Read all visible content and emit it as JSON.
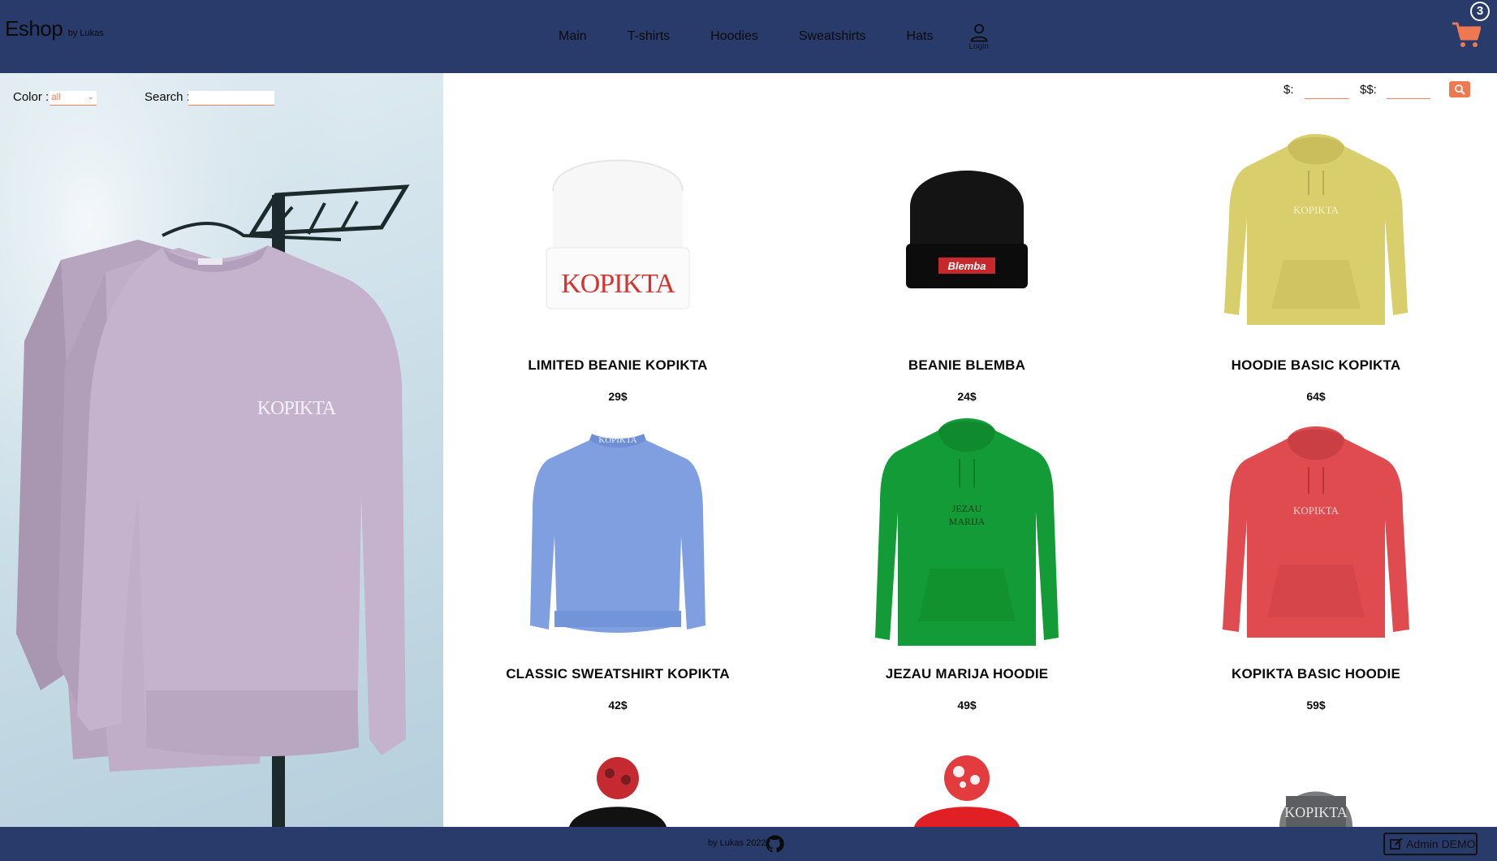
{
  "header": {
    "brand": "Eshop",
    "brand_by": "by Lukas",
    "nav": [
      "Main",
      "T-shirts",
      "Hoodies",
      "Sweatshirts",
      "Hats"
    ],
    "login_label": "Login",
    "cart_count": "3",
    "icons": {
      "login": "user-icon",
      "cart": "cart-icon"
    }
  },
  "filters": {
    "color_label": "Color :",
    "color_value": "all",
    "search_label": "Search :",
    "search_value": ""
  },
  "price_filter": {
    "min_label": "$:",
    "max_label": "$$:",
    "min_value": "",
    "max_value": ""
  },
  "products": [
    {
      "title": "LIMITED BEANIE KOPIKTA",
      "price": "29$",
      "color": "#f5f5f5",
      "kind": "beanie",
      "print": "KOPIKTA"
    },
    {
      "title": "BEANIE BLEMBA",
      "price": "24$",
      "color": "#151515",
      "kind": "beanie",
      "print": "Blemba"
    },
    {
      "title": "HOODIE BASIC KOPIKTA",
      "price": "64$",
      "color": "#d8cd6a",
      "kind": "hoodie",
      "print": "KOPIKTA"
    },
    {
      "title": "CLASSIC SWEATSHIRT KOPIKTA",
      "price": "42$",
      "color": "#7d9ee0",
      "kind": "sweatshirt",
      "print": "KOPIKTA"
    },
    {
      "title": "JEZAU MARIJA HOODIE",
      "price": "49$",
      "color": "#129a35",
      "kind": "hoodie",
      "print": "JEZAU MARIJA"
    },
    {
      "title": "KOPIKTA BASIC HOODIE",
      "price": "59$",
      "color": "#de4a4e",
      "kind": "hoodie",
      "print": "KOPIKTA"
    }
  ],
  "footer": {
    "credit": "by Lukas 2022",
    "admin_label": "Admin DEMO"
  },
  "theme": {
    "header_bg": "#283b6b",
    "accent": "#f07850"
  }
}
